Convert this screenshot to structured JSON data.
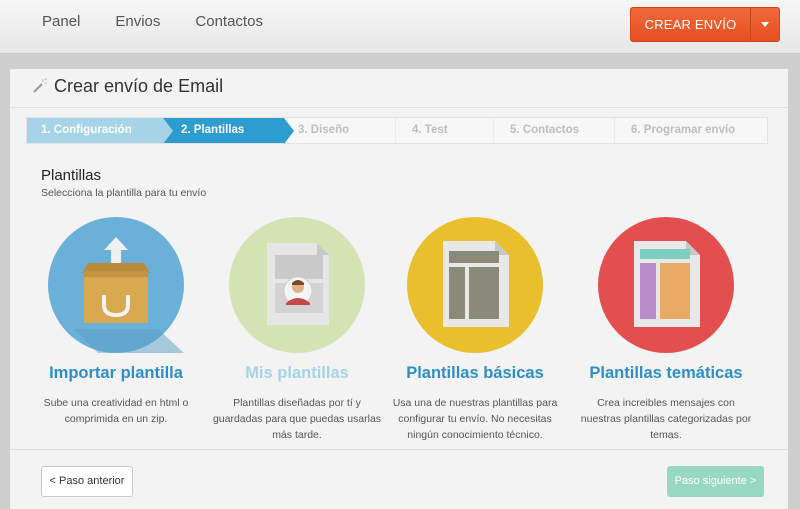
{
  "nav": {
    "items": [
      "Panel",
      "Envios",
      "Contactos"
    ]
  },
  "create_button": {
    "label": "CREAR ENVÍO",
    "caret_icon": "chevron-down-icon",
    "color": "#e8562a"
  },
  "page": {
    "title": "Crear envío de Email",
    "title_icon": "magic-wand-icon"
  },
  "steps": [
    {
      "label": "1. Configuración",
      "state": "done"
    },
    {
      "label": "2. Plantillas",
      "state": "active"
    },
    {
      "label": "3. Diseño",
      "state": "pending"
    },
    {
      "label": "4. Test",
      "state": "pending"
    },
    {
      "label": "5. Contactos",
      "state": "pending"
    },
    {
      "label": "6. Programar envío",
      "state": "pending"
    }
  ],
  "section": {
    "title": "Plantillas",
    "subtitle": "Selecciona la plantilla para tu envío"
  },
  "cards": [
    {
      "title": "Importar plantilla",
      "desc": "Sube una creatividad en html o comprimida en un zip.",
      "color": "#6ab0d8",
      "title_color": "#2e8fc8",
      "icon": "upload-box-icon"
    },
    {
      "title": "Mis plantillas",
      "desc": "Plantillas diseñadas por tí y guardadas para que puedas usarlas más tarde.",
      "color": "#d3e3b4",
      "title_color": "#a4d3e6",
      "icon": "user-template-icon"
    },
    {
      "title": "Plantillas básicas",
      "desc": "Usa una de nuestras plantillas para configurar tu envío. No necesitas ningún conocimiento técnico.",
      "color": "#eabf2d",
      "title_color": "#2e8fc8",
      "icon": "basic-layout-icon"
    },
    {
      "title": "Plantillas temáticas",
      "desc": "Crea increibles mensajes con nuestras plantillas categorizadas por temas.",
      "color": "#e34e4e",
      "title_color": "#2e8fc8",
      "icon": "themed-layout-icon"
    }
  ],
  "footer": {
    "prev_label": "< Paso anterior",
    "next_label": "Paso siguiente >"
  }
}
